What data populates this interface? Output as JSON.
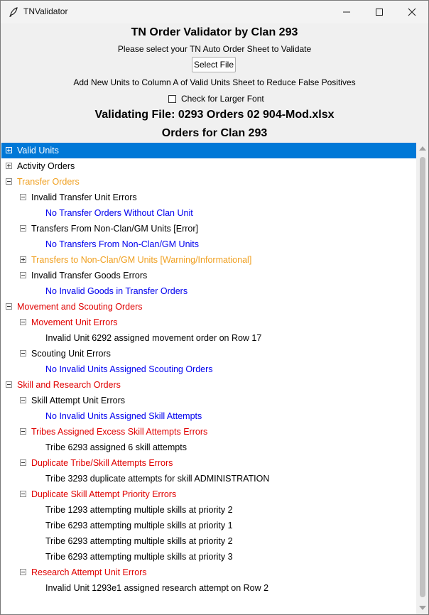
{
  "window": {
    "title": "TNValidator",
    "controls": {
      "minimize": "minimize",
      "maximize": "maximize",
      "close": "close"
    }
  },
  "header": {
    "title": "TN Order Validator by Clan 293",
    "instruction": "Please select your TN Auto Order Sheet to Validate",
    "select_button": "Select File",
    "add_units_note": "Add New Units to Column A of Valid Units Sheet to Reduce False Positives",
    "larger_font_label": "Check for Larger Font",
    "larger_font_checked": false,
    "validating_file": "Validating File: 0293 Orders 02 904-Mod.xlsx",
    "orders_for": "Orders for Clan 293"
  },
  "colors": {
    "black": "#000000",
    "blue": "#0000ee",
    "red": "#e00000",
    "orange": "#f0a020",
    "selected": "#0078d7"
  },
  "tree": [
    {
      "label": "Valid Units",
      "level": 0,
      "expander": "plus",
      "color": "white",
      "selected": true
    },
    {
      "label": "Activity Orders",
      "level": 0,
      "expander": "plus",
      "color": "black"
    },
    {
      "label": "Transfer Orders",
      "level": 0,
      "expander": "minus",
      "color": "orange"
    },
    {
      "label": "Invalid Transfer Unit Errors",
      "level": 1,
      "expander": "minus",
      "color": "black"
    },
    {
      "label": "No Transfer Orders Without Clan Unit",
      "level": 2,
      "expander": "none",
      "color": "blue"
    },
    {
      "label": "Transfers From Non-Clan/GM Units [Error]",
      "level": 1,
      "expander": "minus",
      "color": "black"
    },
    {
      "label": "No Transfers From Non-Clan/GM Units",
      "level": 2,
      "expander": "none",
      "color": "blue"
    },
    {
      "label": "Transfers to Non-Clan/GM Units [Warning/Informational]",
      "level": 1,
      "expander": "plus",
      "color": "orange"
    },
    {
      "label": "Invalid Transfer Goods Errors",
      "level": 1,
      "expander": "minus",
      "color": "black"
    },
    {
      "label": "No Invalid Goods in Transfer Orders",
      "level": 2,
      "expander": "none",
      "color": "blue"
    },
    {
      "label": "Movement and Scouting Orders",
      "level": 0,
      "expander": "minus",
      "color": "red"
    },
    {
      "label": "Movement Unit Errors",
      "level": 1,
      "expander": "minus",
      "color": "red"
    },
    {
      "label": "Invalid Unit 6292 assigned movement order on Row 17",
      "level": 2,
      "expander": "none",
      "color": "black"
    },
    {
      "label": "Scouting Unit Errors",
      "level": 1,
      "expander": "minus",
      "color": "black"
    },
    {
      "label": "No Invalid Units Assigned Scouting Orders",
      "level": 2,
      "expander": "none",
      "color": "blue"
    },
    {
      "label": "Skill and Research Orders",
      "level": 0,
      "expander": "minus",
      "color": "red"
    },
    {
      "label": "Skill Attempt Unit Errors",
      "level": 1,
      "expander": "minus",
      "color": "black"
    },
    {
      "label": "No Invalid Units Assigned Skill Attempts",
      "level": 2,
      "expander": "none",
      "color": "blue"
    },
    {
      "label": "Tribes Assigned Excess Skill Attempts Errors",
      "level": 1,
      "expander": "minus",
      "color": "red"
    },
    {
      "label": "Tribe 6293 assigned 6 skill attempts",
      "level": 2,
      "expander": "none",
      "color": "black"
    },
    {
      "label": "Duplicate Tribe/Skill Attempts Errors",
      "level": 1,
      "expander": "minus",
      "color": "red"
    },
    {
      "label": "Tribe 3293 duplicate attempts for skill ADMINISTRATION",
      "level": 2,
      "expander": "none",
      "color": "black"
    },
    {
      "label": "Duplicate Skill Attempt Priority Errors",
      "level": 1,
      "expander": "minus",
      "color": "red"
    },
    {
      "label": "Tribe 1293 attempting multiple skills at priority 2",
      "level": 2,
      "expander": "none",
      "color": "black"
    },
    {
      "label": "Tribe 6293 attempting multiple skills at priority 1",
      "level": 2,
      "expander": "none",
      "color": "black"
    },
    {
      "label": "Tribe 6293 attempting multiple skills at priority 2",
      "level": 2,
      "expander": "none",
      "color": "black"
    },
    {
      "label": "Tribe 6293 attempting multiple skills at priority 3",
      "level": 2,
      "expander": "none",
      "color": "black"
    },
    {
      "label": "Research Attempt Unit Errors",
      "level": 1,
      "expander": "minus",
      "color": "red"
    },
    {
      "label": "Invalid Unit 1293e1 assigned research attempt on Row 2",
      "level": 2,
      "expander": "none",
      "color": "black"
    }
  ]
}
